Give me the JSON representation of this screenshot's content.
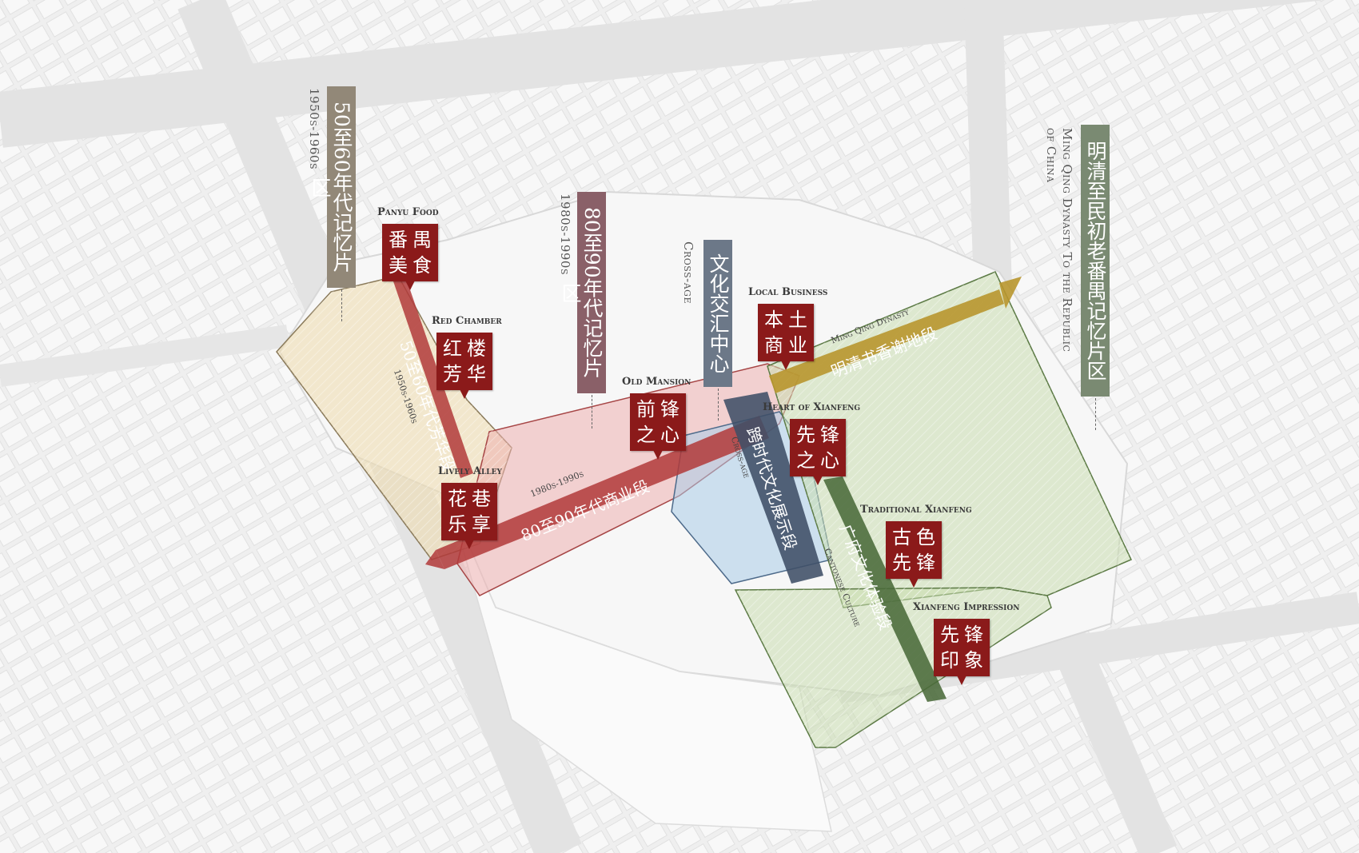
{
  "colors": {
    "memory_1950s": "#928878",
    "memory_1980s": "#8a6068",
    "cross_age": "#6c7888",
    "ming_qing": "#7a8a72",
    "pin": "#8b1a1a",
    "zone_yellow": "#efdcb0",
    "zone_red": "#eeb0b0",
    "zone_blue": "#a9cce8",
    "zone_green": "#c8dcae",
    "path_gold": "#b8962e",
    "path_red": "#b23a3a",
    "path_navy": "#3f4f66",
    "path_green": "#4a6a3a"
  },
  "district_labels": {
    "d1950": {
      "zh": "50至60年代记忆片区",
      "en": "1950s-1960s"
    },
    "d1980": {
      "zh": "80至90年代记忆片区",
      "en": "1980s-1990s"
    },
    "cross": {
      "zh": "文化交汇中心",
      "en": "Cross-age"
    },
    "mingqing": {
      "zh": "明清至民初老番禺记忆片区",
      "en1": "Ming Qing Dynasty To the Republic",
      "en2": "of China"
    }
  },
  "pins": {
    "panyu": {
      "en": "Panyu Food",
      "zh1": "番禺",
      "zh2": "美食"
    },
    "red_chamber": {
      "en": "Red Chamber",
      "zh1": "红楼",
      "zh2": "芳华"
    },
    "lively_alley": {
      "en": "Lively Alley",
      "zh1": "花巷",
      "zh2": "乐享"
    },
    "old_mansion": {
      "en": "Old Mansion",
      "zh1": "前锋",
      "zh2": "之心"
    },
    "local_business": {
      "en": "Local Business",
      "zh1": "本土",
      "zh2": "商业"
    },
    "heart": {
      "en": "Heart of Xianfeng",
      "zh1": "先锋",
      "zh2": "之心"
    },
    "traditional": {
      "en": "Traditional Xianfeng",
      "zh1": "古色",
      "zh2": "先锋"
    },
    "impression": {
      "en": "Xianfeng Impression",
      "zh1": "先锋",
      "zh2": "印象"
    }
  },
  "segments": {
    "seg1950": {
      "zh": "50至60年代芳华段",
      "en": "1950s-1960s"
    },
    "seg1980": {
      "zh": "80至90年代商业段",
      "en": "1980s-1990s"
    },
    "segcross": {
      "zh": "跨时代文化展示段",
      "en": "Cross-age"
    },
    "segming": {
      "zh": "明清书香谢地段",
      "en": "Ming Qing Dynasty"
    },
    "segcanton": {
      "zh": "广府文化体验段",
      "en": "Cantonese Culture"
    }
  }
}
